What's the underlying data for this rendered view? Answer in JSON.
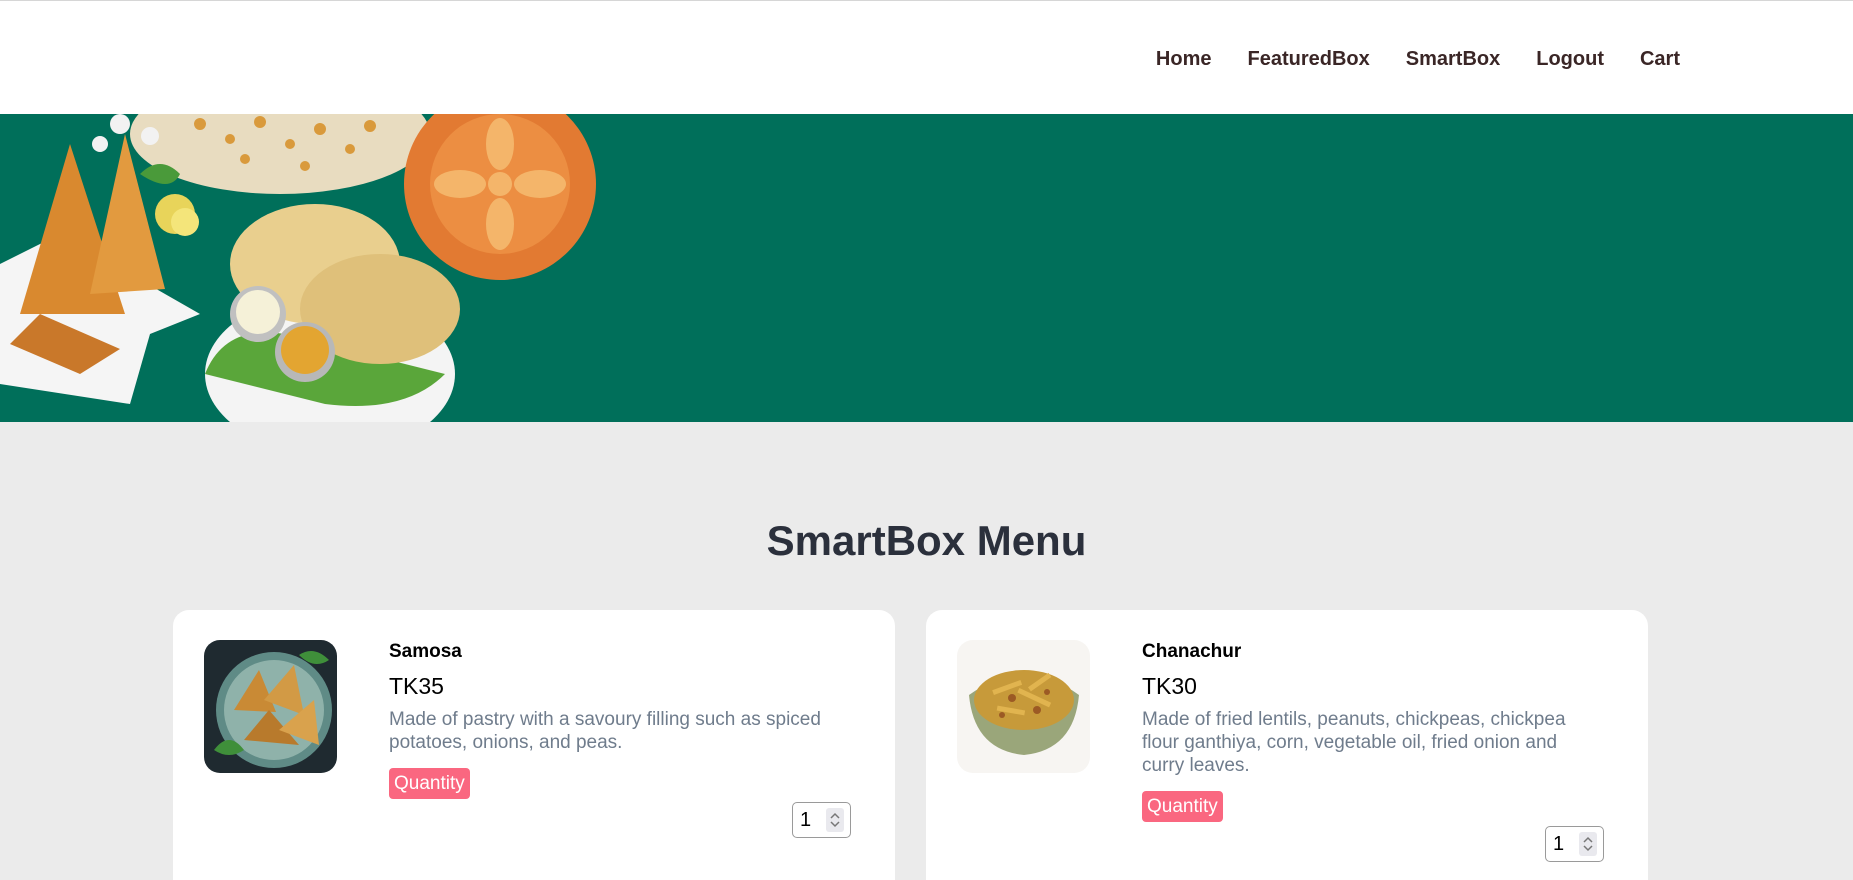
{
  "nav": {
    "items": [
      {
        "label": "Home"
      },
      {
        "label": "FeaturedBox"
      },
      {
        "label": "SmartBox"
      },
      {
        "label": "Logout"
      },
      {
        "label": "Cart"
      }
    ]
  },
  "colors": {
    "hero_bg": "#006f5a",
    "page_bg": "#ebebeb",
    "badge": "#fa6780",
    "desc_text": "#6f7c8c"
  },
  "menu": {
    "title": "SmartBox Menu",
    "items": [
      {
        "name": "Samosa",
        "price": "TK35",
        "description": "Made of pastry with a savoury filling such as spiced potatoes, onions, and peas.",
        "quantity_label": "Quantity",
        "quantity": "1",
        "image_icon": "samosa-plate-image"
      },
      {
        "name": "Chanachur",
        "price": "TK30",
        "description": "Made of fried lentils, peanuts, chickpeas, chickpea flour ganthiya, corn, vegetable oil, fried onion and curry leaves.",
        "quantity_label": "Quantity",
        "quantity": "1",
        "image_icon": "chanachur-bowl-image"
      }
    ]
  }
}
